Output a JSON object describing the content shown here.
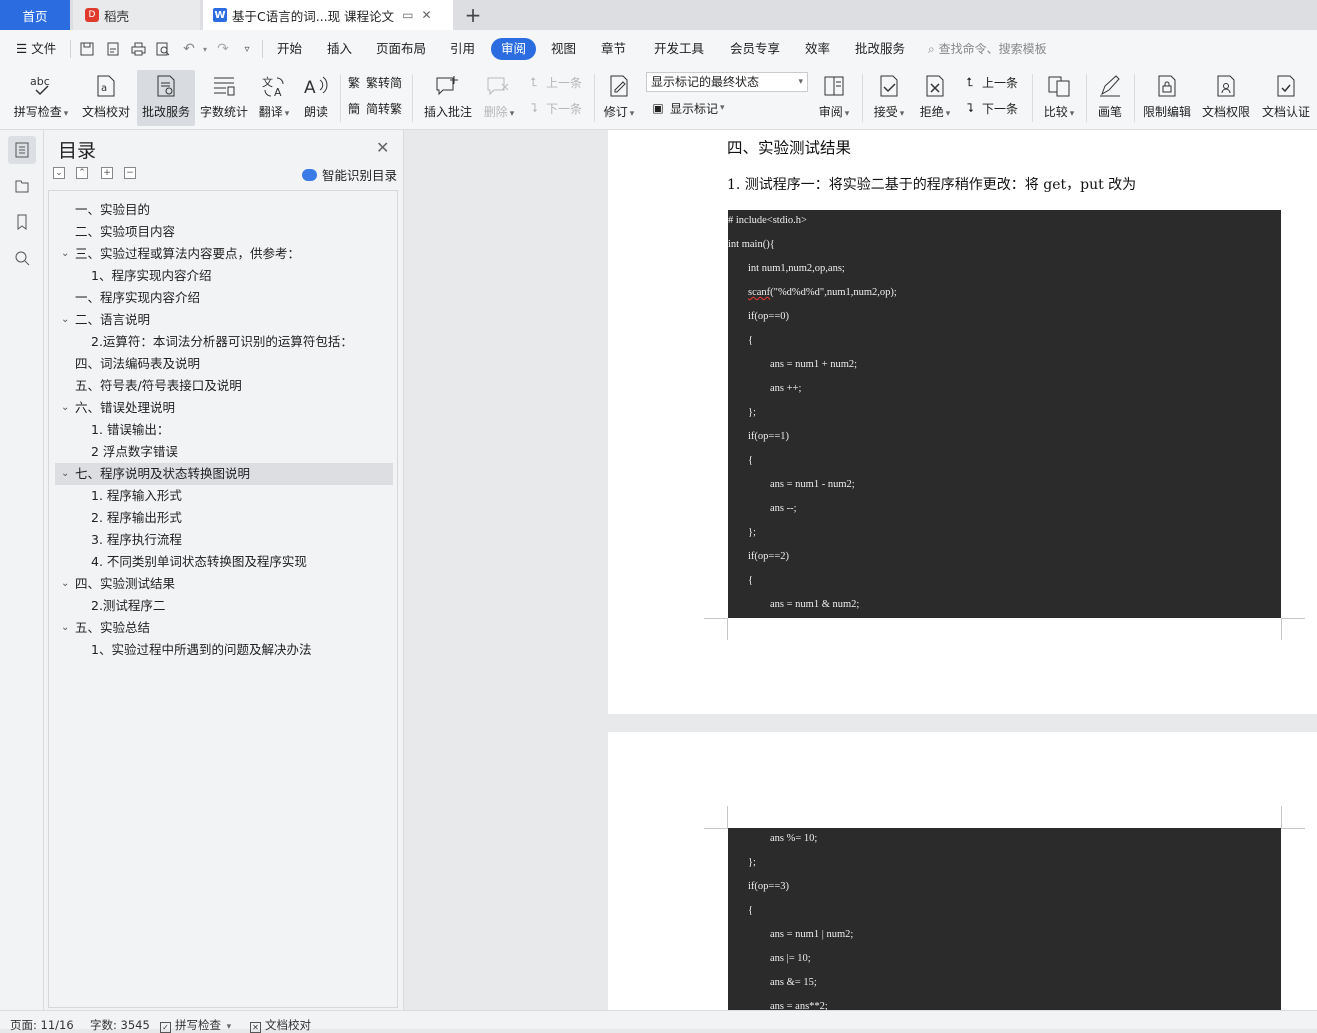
{
  "tabs": {
    "home": "首页",
    "daoke": "稻壳",
    "doc": "基于C语言的词...现  课程论文",
    "doc_badge": "W",
    "daoke_badge": "D"
  },
  "menu": {
    "file": "文件",
    "items": [
      "开始",
      "插入",
      "页面布局",
      "引用",
      "审阅",
      "视图",
      "章节",
      "开发工具",
      "会员专享",
      "效率",
      "批改服务"
    ],
    "search_placeholder": "查找命令、搜索模板"
  },
  "ribbon": {
    "spell_check": "拼写检查",
    "doc_proofread": "文档校对",
    "correction_service": "批改服务",
    "word_count": "字数统计",
    "translate": "翻译",
    "read_aloud": "朗读",
    "to_traditional": "繁转简",
    "to_simplified": "简转繁",
    "insert_comment": "插入批注",
    "delete": "删除",
    "prev_comment": "上一条",
    "next_comment": "下一条",
    "revise": "修订",
    "markup_state": "显示标记的最终状态",
    "show_markup": "显示标记",
    "review": "审阅",
    "accept": "接受",
    "reject": "拒绝",
    "prev_change": "上一条",
    "next_change": "下一条",
    "compare": "比较",
    "pen": "画笔",
    "restrict_edit": "限制编辑",
    "doc_permission": "文档权限",
    "doc_certify": "文档认证"
  },
  "toc": {
    "title": "目录",
    "smart_recognize": "智能识别目录",
    "items": [
      {
        "text": "一、实验目的",
        "level": 1,
        "expand": false
      },
      {
        "text": "二、实验项目内容",
        "level": 1,
        "expand": false
      },
      {
        "text": "三、实验过程或算法内容要点，供参考：",
        "level": 1,
        "expand": true
      },
      {
        "text": "1、程序实现内容介绍",
        "level": 2,
        "expand": false
      },
      {
        "text": "一、程序实现内容介绍",
        "level": 1,
        "expand": false
      },
      {
        "text": "二、语言说明",
        "level": 1,
        "expand": true
      },
      {
        "text": "2.运算符：本词法分析器可识别的运算符包括：",
        "level": 2,
        "expand": false
      },
      {
        "text": "四、词法编码表及说明",
        "level": 1,
        "expand": false
      },
      {
        "text": "五、符号表/符号表接口及说明",
        "level": 1,
        "expand": false
      },
      {
        "text": "六、错误处理说明",
        "level": 1,
        "expand": true
      },
      {
        "text": "1.   错误输出：",
        "level": 2,
        "expand": false
      },
      {
        "text": "2  浮点数字错误",
        "level": 2,
        "expand": false
      },
      {
        "text": "七、程序说明及状态转换图说明",
        "level": 1,
        "expand": true,
        "selected": true
      },
      {
        "text": "1.  程序输入形式",
        "level": 2,
        "expand": false
      },
      {
        "text": "2.  程序输出形式",
        "level": 2,
        "expand": false
      },
      {
        "text": "3.  程序执行流程",
        "level": 2,
        "expand": false
      },
      {
        "text": "4.  不同类别单词状态转换图及程序实现",
        "level": 2,
        "expand": false
      },
      {
        "text": "四、实验测试结果",
        "level": 1,
        "expand": true
      },
      {
        "text": "2.测试程序二",
        "level": 2,
        "expand": false
      },
      {
        "text": "五、实验总结",
        "level": 1,
        "expand": true
      },
      {
        "text": "1、实验过程中所遇到的问题及解决办法",
        "level": 2,
        "expand": false
      }
    ]
  },
  "document": {
    "heading": "四、实验测试结果",
    "paragraph": "1. 测试程序一：将实验二基于的程序稍作更改：将 get，put 改为",
    "code_page1": [
      {
        "text": "# include<stdio.h>",
        "indent": 0
      },
      {
        "text": "int main(){",
        "indent": 0
      },
      {
        "text": "int num1,num2,op,ans;",
        "indent": 1
      },
      {
        "text": "scanf(\"%d%d%d\",num1,num2,op);",
        "indent": 1,
        "squiggle": "scanf"
      },
      {
        "text": "if(op==0)",
        "indent": 1
      },
      {
        "text": "{",
        "indent": 1
      },
      {
        "text": "ans = num1 + num2;",
        "indent": 2
      },
      {
        "text": "ans ++;",
        "indent": 2
      },
      {
        "text": "};",
        "indent": 1
      },
      {
        "text": "if(op==1)",
        "indent": 1
      },
      {
        "text": "{",
        "indent": 1
      },
      {
        "text": "ans = num1 - num2;",
        "indent": 2
      },
      {
        "text": "ans --;",
        "indent": 2
      },
      {
        "text": "};",
        "indent": 1
      },
      {
        "text": "if(op==2)",
        "indent": 1
      },
      {
        "text": "{",
        "indent": 1
      },
      {
        "text": "ans = num1 & num2;",
        "indent": 2
      }
    ],
    "code_page2": [
      {
        "text": "ans %= 10;",
        "indent": 2
      },
      {
        "text": "};",
        "indent": 1
      },
      {
        "text": "if(op==3)",
        "indent": 1
      },
      {
        "text": "{",
        "indent": 1
      },
      {
        "text": "ans = num1 | num2;",
        "indent": 2
      },
      {
        "text": "ans |= 10;",
        "indent": 2
      },
      {
        "text": "ans &= 15;",
        "indent": 2
      },
      {
        "text": "ans = ans**2;",
        "indent": 2
      }
    ]
  },
  "status": {
    "page": "页面: 11/16",
    "word_count": "字数: 3545",
    "spell_check": "拼写检查",
    "doc_proofread": "文档校对"
  },
  "colors": {
    "accent": "#2b6de0",
    "code_bg": "#2b2b2b"
  }
}
